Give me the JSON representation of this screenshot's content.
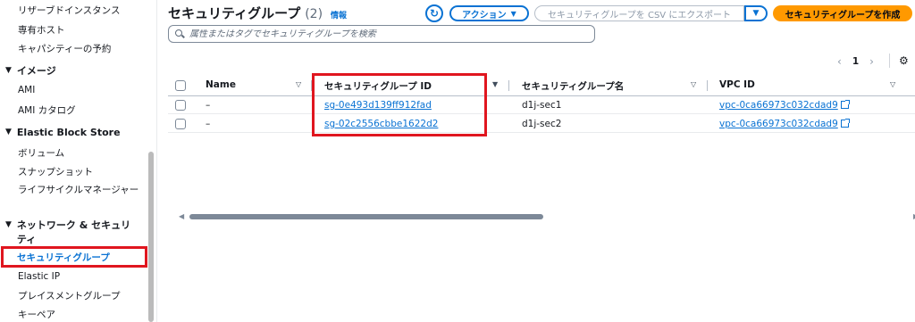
{
  "sidebar": {
    "items_top": [
      {
        "label": "リザーブドインスタンス"
      },
      {
        "label": "専有ホスト"
      },
      {
        "label": "キャパシティーの予約"
      }
    ],
    "groups": [
      {
        "title": "イメージ",
        "items": [
          "AMI",
          "AMI カタログ"
        ]
      },
      {
        "title": "Elastic Block Store",
        "items": [
          "ボリューム",
          "スナップショット",
          "ライフサイクルマネージャー"
        ]
      },
      {
        "title": "ネットワーク & セキュリティ",
        "items": [
          "セキュリティグループ",
          "Elastic IP",
          "プレイスメントグループ",
          "キーペア"
        ]
      }
    ],
    "active_item": "セキュリティグループ"
  },
  "header": {
    "title": "セキュリティグループ",
    "count": "(2)",
    "info": "情報",
    "actions_label": "アクション",
    "export_label": "セキュリティグループを CSV にエクスポート",
    "create_label": "セキュリティグループを作成"
  },
  "search": {
    "placeholder": "属性またはタグでセキュリティグループを検索"
  },
  "pagination": {
    "current": "1"
  },
  "table": {
    "columns": [
      "Name",
      "セキュリティグループ ID",
      "セキュリティグループ名",
      "VPC ID"
    ],
    "rows": [
      {
        "name": "–",
        "sg_id": "sg-0e493d139ff912fad",
        "sg_name": "d1j-sec1",
        "vpc_id": "vpc-0ca66973c032cdad9"
      },
      {
        "name": "–",
        "sg_id": "sg-02c2556cbbe1622d2",
        "sg_name": "d1j-sec2",
        "vpc_id": "vpc-0ca66973c032cdad9"
      }
    ]
  },
  "colors": {
    "accent": "#0972d3",
    "primary_button": "#ff9900",
    "highlight": "#e0161f"
  },
  "icons": [
    "refresh-icon",
    "search-icon",
    "settings-icon",
    "external-link-icon",
    "sort-icon",
    "chevron-left-icon",
    "chevron-right-icon",
    "caret-down-icon"
  ]
}
